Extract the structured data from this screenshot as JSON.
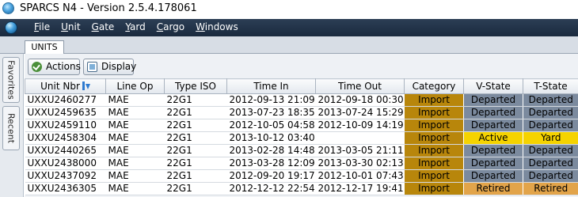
{
  "window": {
    "title": "SPARCS N4 - Version 2.5.4.178061"
  },
  "menu": [
    {
      "underline": "F",
      "rest": "ile"
    },
    {
      "underline": "U",
      "rest": "nit"
    },
    {
      "underline": "G",
      "rest": "ate"
    },
    {
      "underline": "Y",
      "rest": "ard"
    },
    {
      "underline": "C",
      "rest": "argo"
    },
    {
      "underline": "W",
      "rest": "indows"
    }
  ],
  "tabs": {
    "active": "UNITS"
  },
  "sidebar": {
    "favorites": "Favorites",
    "recent": "Recent"
  },
  "toolbar": {
    "actions_label": "Actions",
    "display_label": "Display"
  },
  "table": {
    "columns": [
      "Unit Nbr",
      "Line Op",
      "Type ISO",
      "Time In",
      "Time Out",
      "Category",
      "V-State",
      "T-State"
    ],
    "rows": [
      {
        "unit": "UXXU2460277",
        "line_op": "MAE",
        "type_iso": "22G1",
        "time_in": "2012-09-13 21:09",
        "time_out": "2012-09-18 00:30",
        "category": "Import",
        "v_state": "Departed",
        "t_state": "Departed"
      },
      {
        "unit": "UXXU2459635",
        "line_op": "MAE",
        "type_iso": "22G1",
        "time_in": "2013-07-23 18:35",
        "time_out": "2013-07-24 15:29",
        "category": "Import",
        "v_state": "Departed",
        "t_state": "Departed"
      },
      {
        "unit": "UXXU2459110",
        "line_op": "MAE",
        "type_iso": "22G1",
        "time_in": "2012-10-05 04:58",
        "time_out": "2012-10-09 14:19",
        "category": "Import",
        "v_state": "Departed",
        "t_state": "Departed"
      },
      {
        "unit": "UXXU2458304",
        "line_op": "MAE",
        "type_iso": "22G1",
        "time_in": "2013-10-12 03:40",
        "time_out": "",
        "category": "Import",
        "v_state": "Active",
        "t_state": "Yard"
      },
      {
        "unit": "UXXU2440265",
        "line_op": "MAE",
        "type_iso": "22G1",
        "time_in": "2013-02-28 14:48",
        "time_out": "2013-03-05 21:11",
        "category": "Import",
        "v_state": "Departed",
        "t_state": "Departed"
      },
      {
        "unit": "UXXU2438000",
        "line_op": "MAE",
        "type_iso": "22G1",
        "time_in": "2013-03-28 12:09",
        "time_out": "2013-03-30 02:13",
        "category": "Import",
        "v_state": "Departed",
        "t_state": "Departed"
      },
      {
        "unit": "UXXU2437092",
        "line_op": "MAE",
        "type_iso": "22G1",
        "time_in": "2012-09-20 19:17",
        "time_out": "2012-10-01 07:43",
        "category": "Import",
        "v_state": "Departed",
        "t_state": "Departed"
      },
      {
        "unit": "UXXU2436305",
        "line_op": "MAE",
        "type_iso": "22G1",
        "time_in": "2012-12-12 22:54",
        "time_out": "2012-12-17 19:41",
        "category": "Import",
        "v_state": "Retired",
        "t_state": "Retired"
      }
    ]
  },
  "colors": {
    "category_import": "#b8860b",
    "state_departed": "#7b8a9e",
    "state_active": "#f5d300",
    "state_retired": "#e2a44a"
  }
}
